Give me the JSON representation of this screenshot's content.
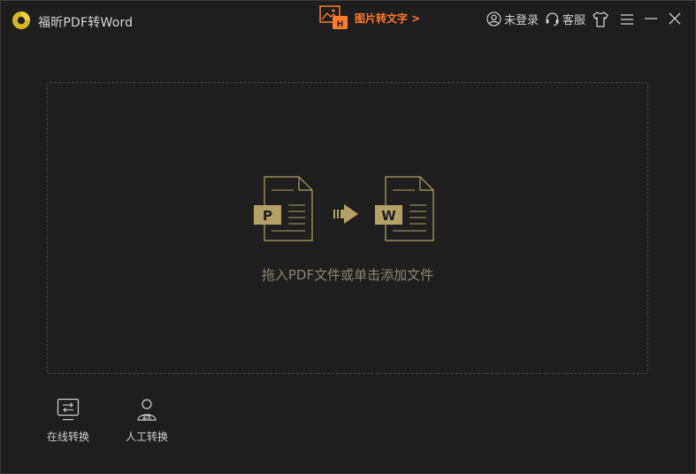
{
  "app": {
    "title": "福昕PDF转Word"
  },
  "header": {
    "promo_label": "图片转文字 >",
    "login_label": "未登录",
    "service_label": "客服"
  },
  "dropzone": {
    "hint": "拖入PDF文件或单击添加文件",
    "from_letter": "P",
    "to_letter": "W"
  },
  "tools": [
    {
      "label": "在线转换",
      "icon": "online-convert-icon"
    },
    {
      "label": "人工转换",
      "icon": "manual-convert-icon"
    }
  ],
  "colors": {
    "background": "#1e1e1e",
    "accent_gold": "#b3a165",
    "hint_text": "#8d8470",
    "promo_orange": "#ff7a2a"
  }
}
